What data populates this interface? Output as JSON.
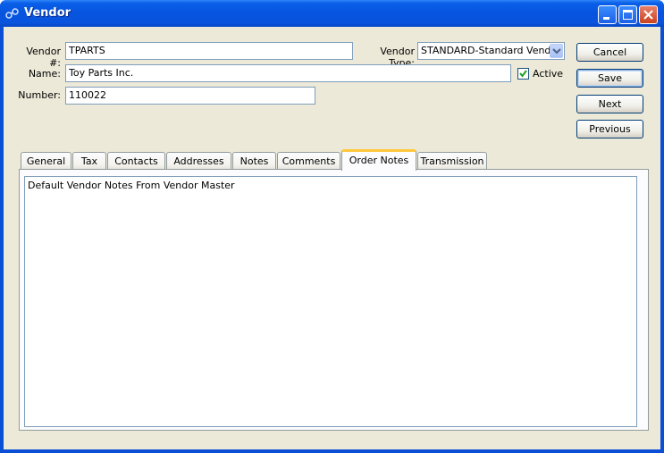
{
  "window": {
    "title": "Vendor",
    "icon": "xtuple-app-icon",
    "controls": [
      "minimize-icon",
      "maximize-icon",
      "close-icon"
    ]
  },
  "form": {
    "vendor_number": {
      "label": "Vendor #:",
      "value": "TPARTS"
    },
    "vendor_type": {
      "label": "Vendor Type:",
      "value": "STANDARD-Standard Vendor"
    },
    "name": {
      "label": "Name:",
      "value": "Toy Parts Inc."
    },
    "active": {
      "label": "Active",
      "checked": true
    },
    "number": {
      "label": "Number:",
      "value": "110022"
    }
  },
  "buttons": {
    "cancel": "Cancel",
    "save": "Save",
    "next": "Next",
    "previous": "Previous"
  },
  "tabs": [
    {
      "label": "General"
    },
    {
      "label": "Tax"
    },
    {
      "label": "Contacts"
    },
    {
      "label": "Addresses"
    },
    {
      "label": "Notes"
    },
    {
      "label": "Comments"
    },
    {
      "label": "Order Notes",
      "active": true
    },
    {
      "label": "Transmission"
    }
  ],
  "order_notes": {
    "text": "Default Vendor Notes From Vendor Master"
  },
  "colors": {
    "titlebar": "#0653df",
    "client_bg": "#ece9d8",
    "active_tab_accent": "#ffc83c",
    "field_border": "#7f9db9"
  }
}
